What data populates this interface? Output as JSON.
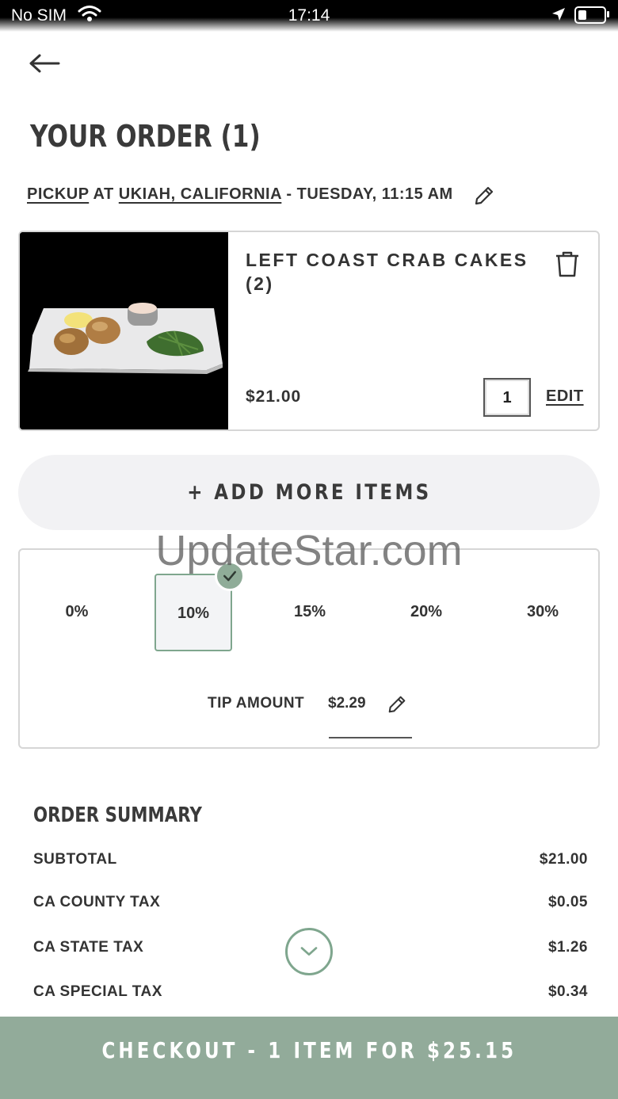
{
  "status_bar": {
    "carrier": "No SIM",
    "time": "17:14"
  },
  "header": {
    "title": "YOUR ORDER (1)"
  },
  "pickup": {
    "mode": "PICKUP",
    "at": "AT",
    "location": "UKIAH, CALIFORNIA",
    "time": "- TUESDAY, 11:15 AM"
  },
  "item": {
    "name": "LEFT COAST CRAB CAKES (2)",
    "price": "$21.00",
    "quantity": "1",
    "edit_label": "EDIT"
  },
  "add_more_label": "+ ADD MORE ITEMS",
  "tip": {
    "options": [
      "0%",
      "10%",
      "15%",
      "20%",
      "30%"
    ],
    "selected": "10%",
    "amount_label": "TIP AMOUNT",
    "amount": "$2.29"
  },
  "watermark": "UpdateStar.com",
  "summary": {
    "title": "ORDER SUMMARY",
    "rows": [
      {
        "label": "SUBTOTAL",
        "value": "$21.00"
      },
      {
        "label": "CA COUNTY TAX",
        "value": "$0.05"
      },
      {
        "label": "CA STATE TAX",
        "value": "$1.26"
      },
      {
        "label": "CA SPECIAL TAX",
        "value": "$0.34"
      }
    ]
  },
  "checkout_label": "CHECKOUT - 1 ITEM FOR $25.15",
  "colors": {
    "accent": "#92ab9a",
    "selected_border": "#7fa68e",
    "text": "#333333"
  }
}
